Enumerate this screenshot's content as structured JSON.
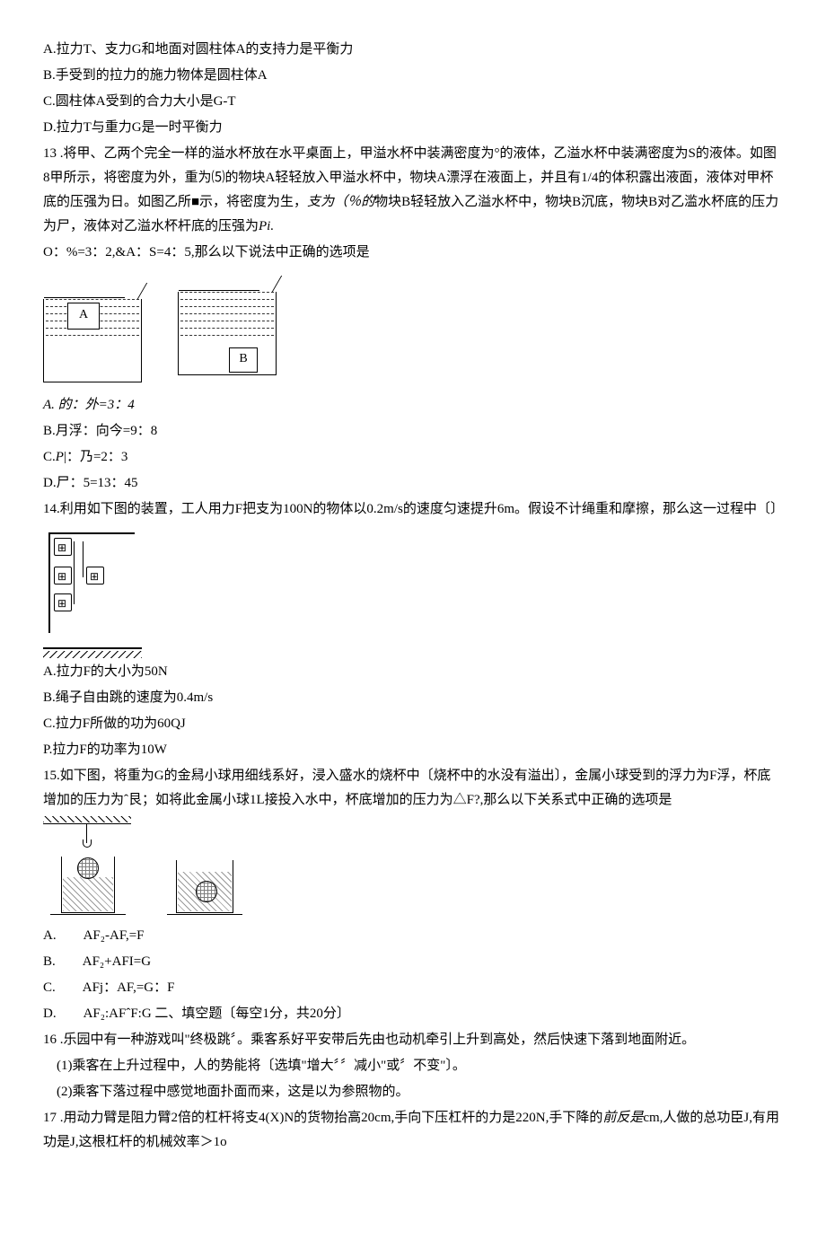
{
  "q12": {
    "a": "A.拉力T、支力G和地面对圆柱体A的支持力是平衡力",
    "b": "B.手受到的拉力的施力物体是圆柱体A",
    "c": "C.圆柱体A受到的合力大小是G-T",
    "d": "D.拉力T与重力G是一时平衡力"
  },
  "q13": {
    "stem1": "13 .将甲、乙两个完全一样的溢水杯放在水平桌面上，甲溢水杯中装满密度为°的液体，乙溢水杯中装满密度为S的液体。如图8甲所示，将密度为外，重为⑸的物块A轻轻放入甲溢水杯中，物块A漂浮在液面上，并且有1/4的体积露出液面，液体对甲杯底的压强为日。如图乙所■示，将密度为生，",
    "stem1b": "支为（％的",
    "stem1c": "物块B轻轻放入乙溢水杯中，物块B沉底，物块B对乙滥水杯底的压力为尸，液体对乙溢水杯杆底的压强为",
    "stem1d": "Pi.",
    "stem2": "O：%=3：2,&A：S=4：5,那么以下说法中正确的选项是",
    "block_a": "A",
    "block_b": "B",
    "a": "A. 的：外=3：4",
    "b": "B.月浮：向今=9：8",
    "c": "C. P|：乃=2：3",
    "c_prefix": "C.",
    "c_main": "P",
    "d": "D.尸：5=13：45"
  },
  "q14": {
    "stem": "14.利用如下图的装置，工人用力F把支为100N的物体以0.2m/s的速度匀速提升6m。假设不计绳重和摩擦，那么这一过程中〔〕",
    "a": "A.拉力F的大小为50N",
    "b": "B.绳子自由跳的速度为0.4m/s",
    "c": "C.拉力F所做的功为60QJ",
    "d": "P.拉力F的功率为10W"
  },
  "q15": {
    "stem": "15.如下图，将重为G的金舄小球用细线系好，浸入盛水的烧杯中〔烧杯中的水没有溢出〕，金属小球受到的浮力为F浮，杯底增加的压力为ˆ艮；如将此金属小球1L接投入水中，杯底增加的压力为△F?,那么以下关系式中正确的选项是",
    "a": "A.　　AF₂-AF,=F",
    "b": "B.　　AF₂+AFI=G",
    "c": "C.　　AFj：AF,=G：F",
    "d": "D.　　AF₂:AFˆF:G 二、填空题〔每空1分，共20分〕"
  },
  "q16": {
    "stem": "16 .乐园中有一种游戏叫\"终极跳〞。乘客系好平安带后先由也动机牵引上升到高处，然后快速下落到地面附近。",
    "p1": "　(1)乘客在上升过程中，人的势能将〔选填\"增大〞〞减小\"或〞不变\"〕。",
    "p2": "　(2)乘客下落过程中感觉地面扑面而来，这是以为参照物的。"
  },
  "q17": {
    "stem_a": "17 .用动力臂是阻力臂2倍的杠杆将支4(X)N的货物抬高20cm,手向下压杠杆的力是220N,手下降的",
    "stem_b": "前反是",
    "stem_c": "cm,人做的总功臣J,有用功是J,这根杠杆的机械效率＞1o"
  }
}
